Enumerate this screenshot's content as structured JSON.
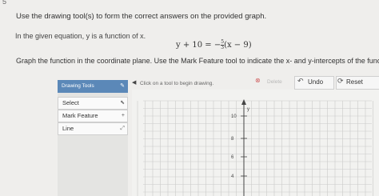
{
  "question_number": "5",
  "instruction": "Use the drawing tool(s) to form the correct answers on the provided graph.",
  "given_text": "In the given equation, y is a function of x.",
  "equation": "y + 10 = −(5/3)(x − 9)",
  "graph_instruction": "Graph the function in the coordinate plane. Use the Mark Feature tool to indicate the x- and y-intercepts of the function.",
  "drawing_tools": {
    "title": "Drawing Tools",
    "items": [
      {
        "label": "Select",
        "icon": "cursor-icon"
      },
      {
        "label": "Mark Feature",
        "icon": "plus-icon"
      },
      {
        "label": "Line",
        "icon": "line-icon"
      }
    ]
  },
  "toolbar": {
    "hint": "Click on a tool to begin drawing.",
    "delete_label": "Delete",
    "undo_label": "Undo",
    "reset_label": "Reset"
  },
  "graph": {
    "y_axis_label": "y",
    "y_tick_labels": [
      "10",
      "8",
      "6",
      "4"
    ],
    "colors": {
      "grid": "#c9c9c9",
      "axis": "#444444",
      "header": "#5b88b8"
    }
  }
}
